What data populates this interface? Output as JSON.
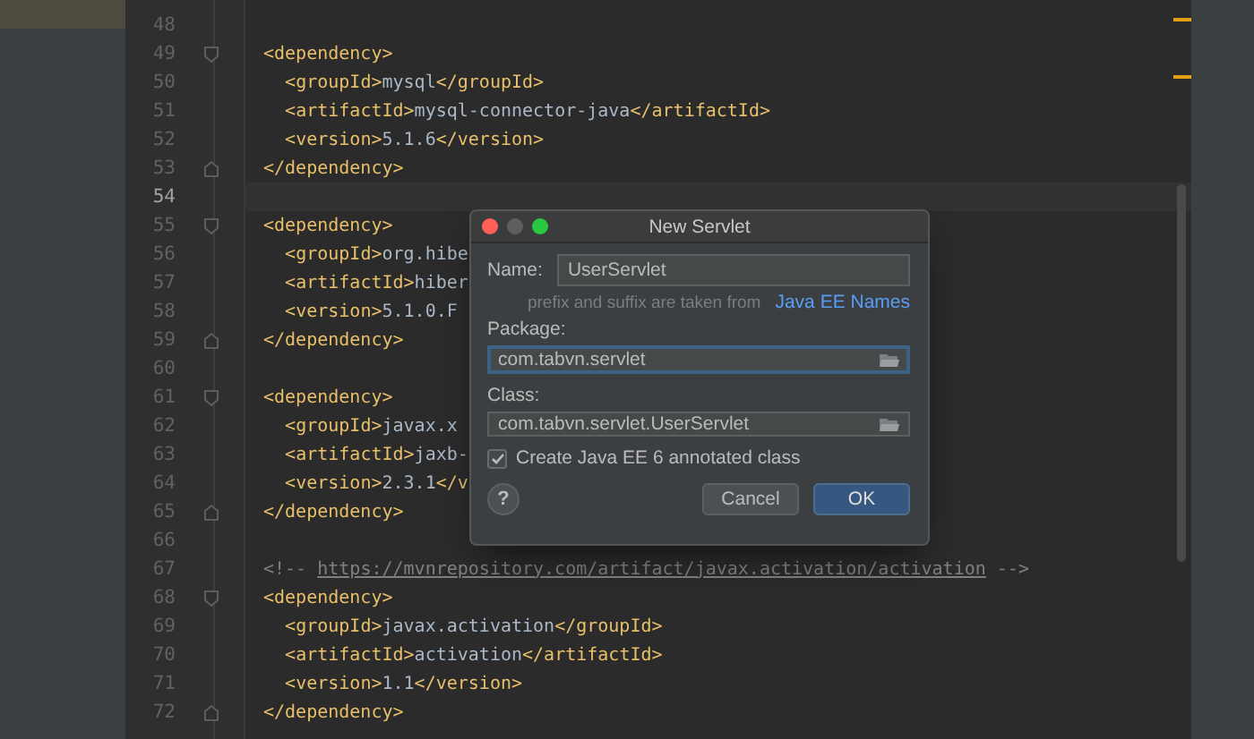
{
  "editor": {
    "lines": [
      {
        "number": "48"
      },
      {
        "number": "49",
        "text": "<dependency>",
        "fold_start": true
      },
      {
        "number": "50",
        "text": "  <groupId>mysql</groupId>"
      },
      {
        "number": "51",
        "text": "  <artifactId>mysql-connector-java</artifactId>"
      },
      {
        "number": "52",
        "text": "  <version>5.1.6</version>"
      },
      {
        "number": "53",
        "text": "</dependency>",
        "fold_start": false
      },
      {
        "number": "54",
        "current": true
      },
      {
        "number": "55",
        "text": "<dependency>",
        "fold_start": true
      },
      {
        "number": "56",
        "text": "  <groupId>org.hibe"
      },
      {
        "number": "57",
        "text": "  <artifactId>hiber"
      },
      {
        "number": "58",
        "text": "  <version>5.1.0.F"
      },
      {
        "number": "59",
        "text": "</dependency>",
        "fold_start": false
      },
      {
        "number": "60"
      },
      {
        "number": "61",
        "text": "<dependency>",
        "fold_start": true
      },
      {
        "number": "62",
        "text": "  <groupId>javax.x"
      },
      {
        "number": "63",
        "text": "  <artifactId>jaxb-"
      },
      {
        "number": "64",
        "text": "  <version>2.3.1</v"
      },
      {
        "number": "65",
        "text": "</dependency>",
        "fold_start": false
      },
      {
        "number": "66"
      },
      {
        "number": "67",
        "kind": "comment",
        "text": "<!-- ",
        "link": "https://mvnrepository.com/artifact/javax.activation/activation",
        "suffix": " -->"
      },
      {
        "number": "68",
        "text": "<dependency>",
        "fold_start": true
      },
      {
        "number": "69",
        "text": "  <groupId>javax.activation</groupId>"
      },
      {
        "number": "70",
        "text": "  <artifactId>activation</artifactId>"
      },
      {
        "number": "71",
        "text": "  <version>1.1</version>"
      },
      {
        "number": "72",
        "text": "</dependency>",
        "fold_start": false
      }
    ]
  },
  "dialog": {
    "title": "New Servlet",
    "name": {
      "label": "Name:",
      "value": "UserServlet",
      "focused": false
    },
    "hint": {
      "text": "prefix and suffix are taken from",
      "link": "Java EE Names"
    },
    "package": {
      "label": "Package:",
      "value": "com.tabvn.servlet",
      "focused": true
    },
    "class": {
      "label": "Class:",
      "value": "com.tabvn.servlet.UserServlet",
      "focused": false
    },
    "annotated": {
      "label": "Create Java EE 6 annotated class",
      "checked": true
    },
    "help": "?",
    "buttons": [
      {
        "label": "Cancel",
        "default": false
      },
      {
        "label": "OK",
        "default": true
      }
    ]
  }
}
